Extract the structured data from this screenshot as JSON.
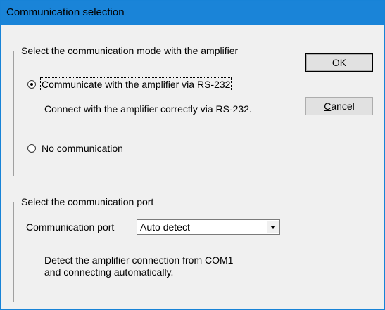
{
  "window": {
    "title": "Communication selection"
  },
  "mode_group": {
    "legend": "Select the communication mode with the amplifier",
    "options": [
      {
        "label": "Communicate with the amplifier via RS-232",
        "selected": true
      },
      {
        "label": "No communication",
        "selected": false
      }
    ],
    "description": "Connect with the amplifier correctly via RS-232."
  },
  "port_group": {
    "legend": "Select the communication port",
    "port_label": "Communication port",
    "port_value": "Auto detect",
    "description_line1": "Detect the amplifier connection from COM1",
    "description_line2": "and connecting automatically."
  },
  "buttons": {
    "ok": {
      "mnemonic": "O",
      "rest": "K"
    },
    "cancel": {
      "mnemonic": "C",
      "rest": "ancel"
    }
  },
  "colors": {
    "titlebar": "#1a84d8",
    "dialog_bg": "#f0f0f0"
  }
}
